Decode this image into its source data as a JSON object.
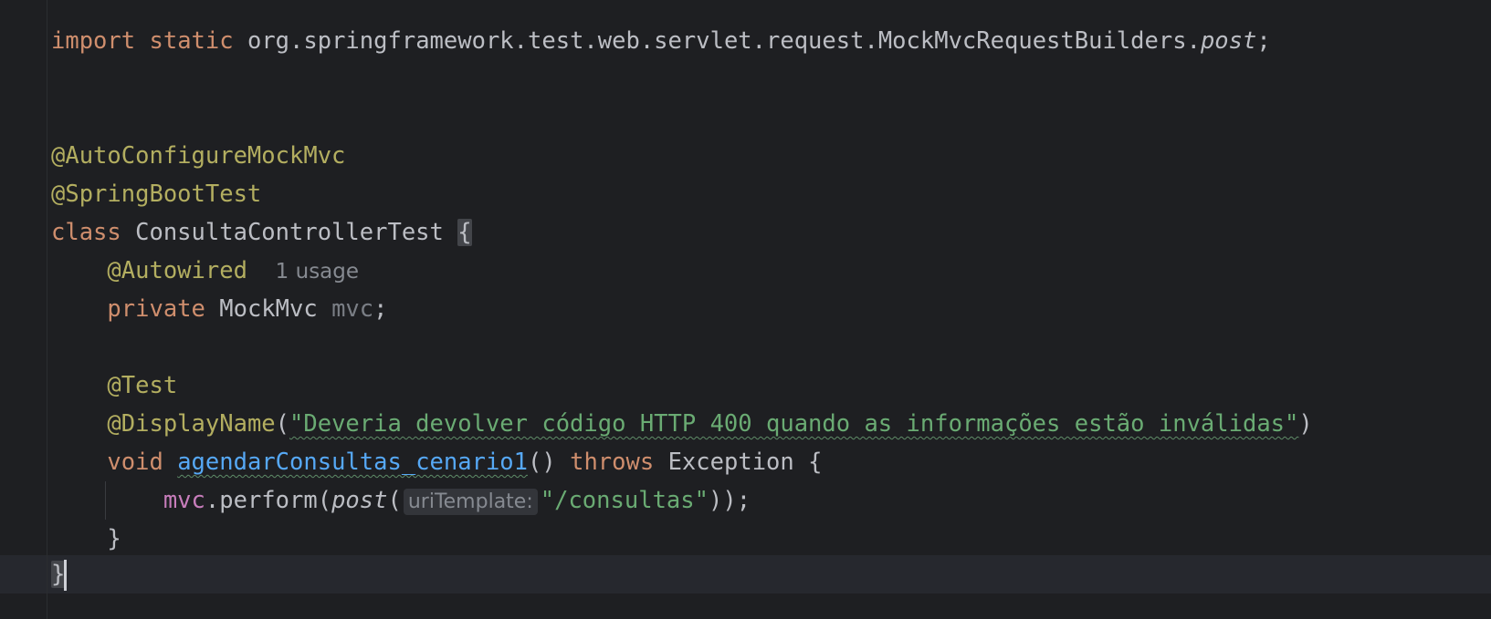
{
  "editor": {
    "lines": {
      "l1": {
        "kw_import": "import",
        "kw_static": "static",
        "package": "org.springframework.test.web.servlet.request.MockMvcRequestBuilders.",
        "method": "post",
        "semicolon": ";"
      },
      "l4": {
        "annotation": "@AutoConfigureMockMvc"
      },
      "l5": {
        "annotation": "@SpringBootTest"
      },
      "l6": {
        "kw_class": "class",
        "class_name": "ConsultaControllerTest",
        "open_brace": "{"
      },
      "l7": {
        "annotation": "@Autowired",
        "usage_hint": "1 usage"
      },
      "l8": {
        "kw_private": "private",
        "type": "MockMvc",
        "field": "mvc",
        "semicolon": ";"
      },
      "l10": {
        "annotation": "@Test"
      },
      "l11": {
        "annotation": "@DisplayName",
        "open_paren": "(",
        "string": "\"Deveria devolver código HTTP 400 quando as informações estão inválidas\"",
        "close_paren": ")"
      },
      "l12": {
        "kw_void": "void",
        "method_name": "agendarConsultas_cenario1",
        "parens": "()",
        "kw_throws": "throws",
        "exception": "Exception",
        "open_brace": "{"
      },
      "l13": {
        "field": "mvc",
        "perform": ".perform(",
        "post": "post",
        "open_paren": "(",
        "param_hint": "uriTemplate:",
        "string": "\"/consultas\"",
        "close": "));"
      },
      "l14": {
        "close_brace": "}"
      },
      "l15": {
        "close_brace": "}"
      }
    }
  }
}
